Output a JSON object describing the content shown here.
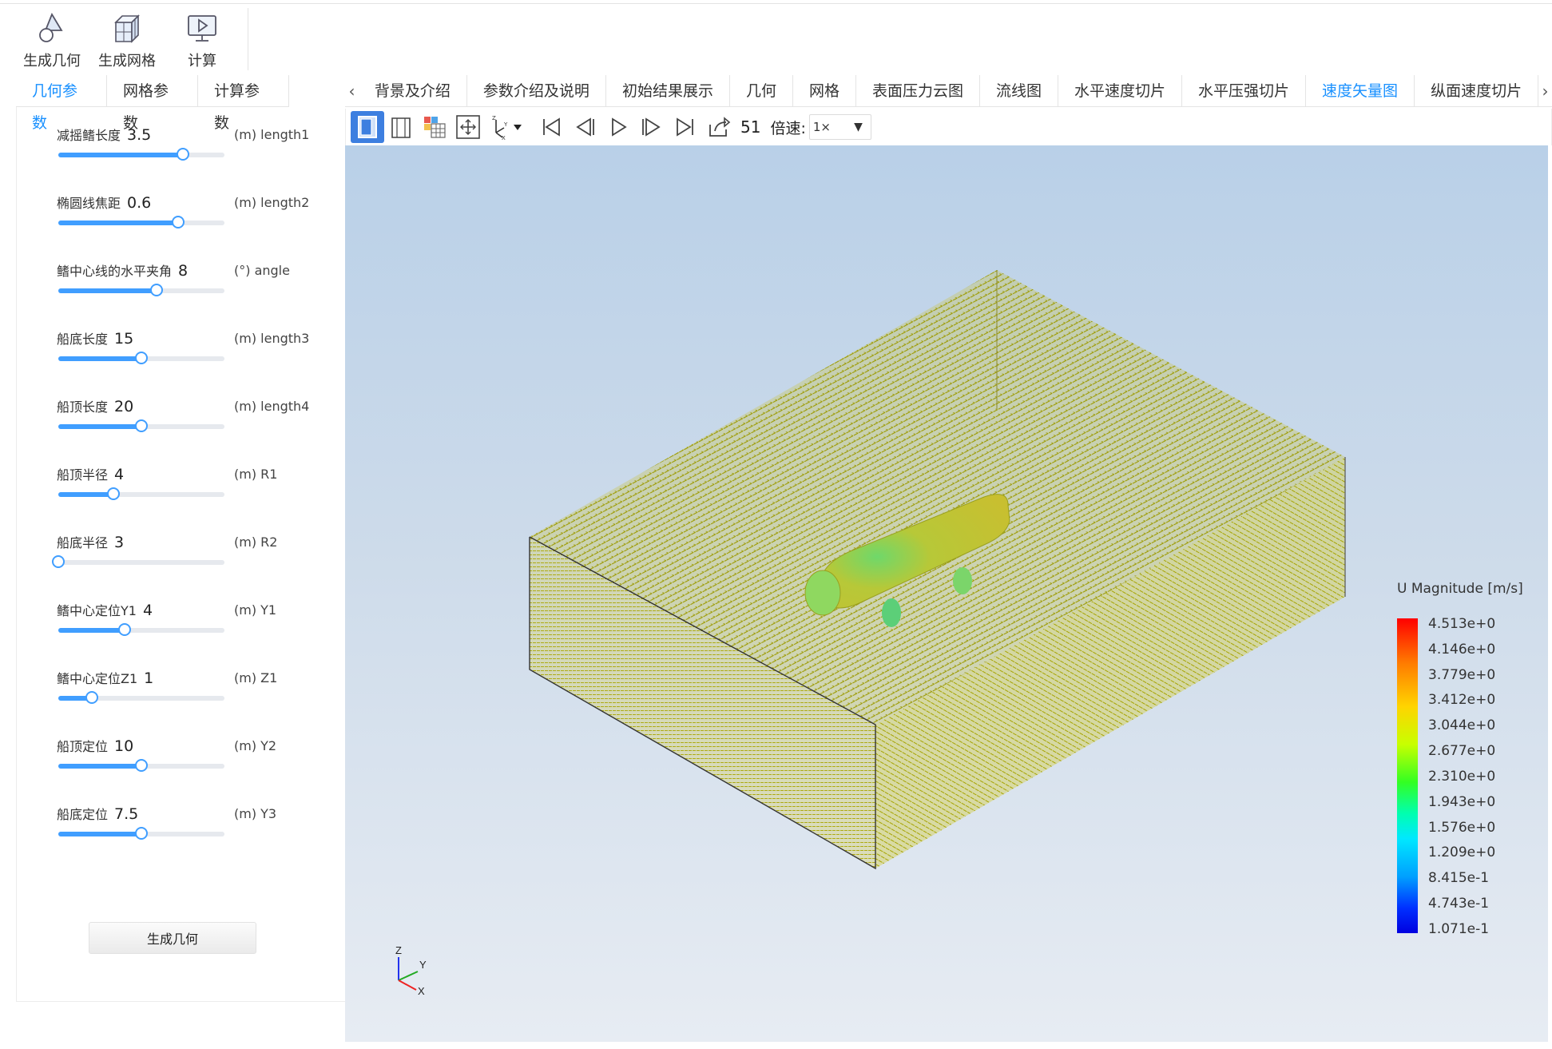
{
  "toolbar": {
    "items": [
      {
        "label": "生成几何",
        "icon": "geometry-icon"
      },
      {
        "label": "生成网格",
        "icon": "mesh-icon"
      },
      {
        "label": "计算",
        "icon": "compute-icon"
      }
    ]
  },
  "left_tabs": [
    {
      "label": "几何参数",
      "active": true
    },
    {
      "label": "网格参数",
      "active": false
    },
    {
      "label": "计算参数",
      "active": false
    }
  ],
  "right_tabs": [
    {
      "label": "背景及介绍",
      "active": false
    },
    {
      "label": "参数介绍及说明",
      "active": false
    },
    {
      "label": "初始结果展示",
      "active": false
    },
    {
      "label": "几何",
      "active": false
    },
    {
      "label": "网格",
      "active": false
    },
    {
      "label": "表面压力云图",
      "active": false
    },
    {
      "label": "流线图",
      "active": false
    },
    {
      "label": "水平速度切片",
      "active": false
    },
    {
      "label": "水平压强切片",
      "active": false
    },
    {
      "label": "速度矢量图",
      "active": true
    },
    {
      "label": "纵面速度切片",
      "active": false
    }
  ],
  "params": [
    {
      "label": "减摇鳍长度",
      "value": "3.5",
      "unit": "(m) length1",
      "fraction": 0.75
    },
    {
      "label": "椭圆线焦距",
      "value": "0.6",
      "unit": "(m) length2",
      "fraction": 0.72
    },
    {
      "label": "鳍中心线的水平夹角",
      "value": "8",
      "unit": "(°) angle",
      "fraction": 0.59
    },
    {
      "label": "船底长度",
      "value": "15",
      "unit": "(m) length3",
      "fraction": 0.5
    },
    {
      "label": "船顶长度",
      "value": "20",
      "unit": "(m) length4",
      "fraction": 0.5
    },
    {
      "label": "船顶半径",
      "value": "4",
      "unit": "(m) R1",
      "fraction": 0.33
    },
    {
      "label": "船底半径",
      "value": "3",
      "unit": "(m) R2",
      "fraction": 0.0
    },
    {
      "label": "鳍中心定位Y1",
      "value": "4",
      "unit": "(m) Y1",
      "fraction": 0.4
    },
    {
      "label": "鳍中心定位Z1",
      "value": "1",
      "unit": "(m) Z1",
      "fraction": 0.2
    },
    {
      "label": "船顶定位",
      "value": "10",
      "unit": "(m) Y2",
      "fraction": 0.5
    },
    {
      "label": "船底定位",
      "value": "7.5",
      "unit": "(m) Y3",
      "fraction": 0.5
    }
  ],
  "generate_button": "生成几何",
  "viewer": {
    "frame": "51",
    "speed_label": "倍速:",
    "speed_value": "1×"
  },
  "legend": {
    "title": "U Magnitude [m/s]",
    "labels": [
      "4.513e+0",
      "4.146e+0",
      "3.779e+0",
      "3.412e+0",
      "3.044e+0",
      "2.677e+0",
      "2.310e+0",
      "1.943e+0",
      "1.576e+0",
      "1.209e+0",
      "8.415e-1",
      "4.743e-1",
      "1.071e-1"
    ]
  },
  "axes": {
    "z": "Z",
    "y": "Y",
    "x": "X"
  },
  "colors": {
    "accent": "#1890ff",
    "vector": "#b8b800",
    "hull": "#a8b830"
  }
}
